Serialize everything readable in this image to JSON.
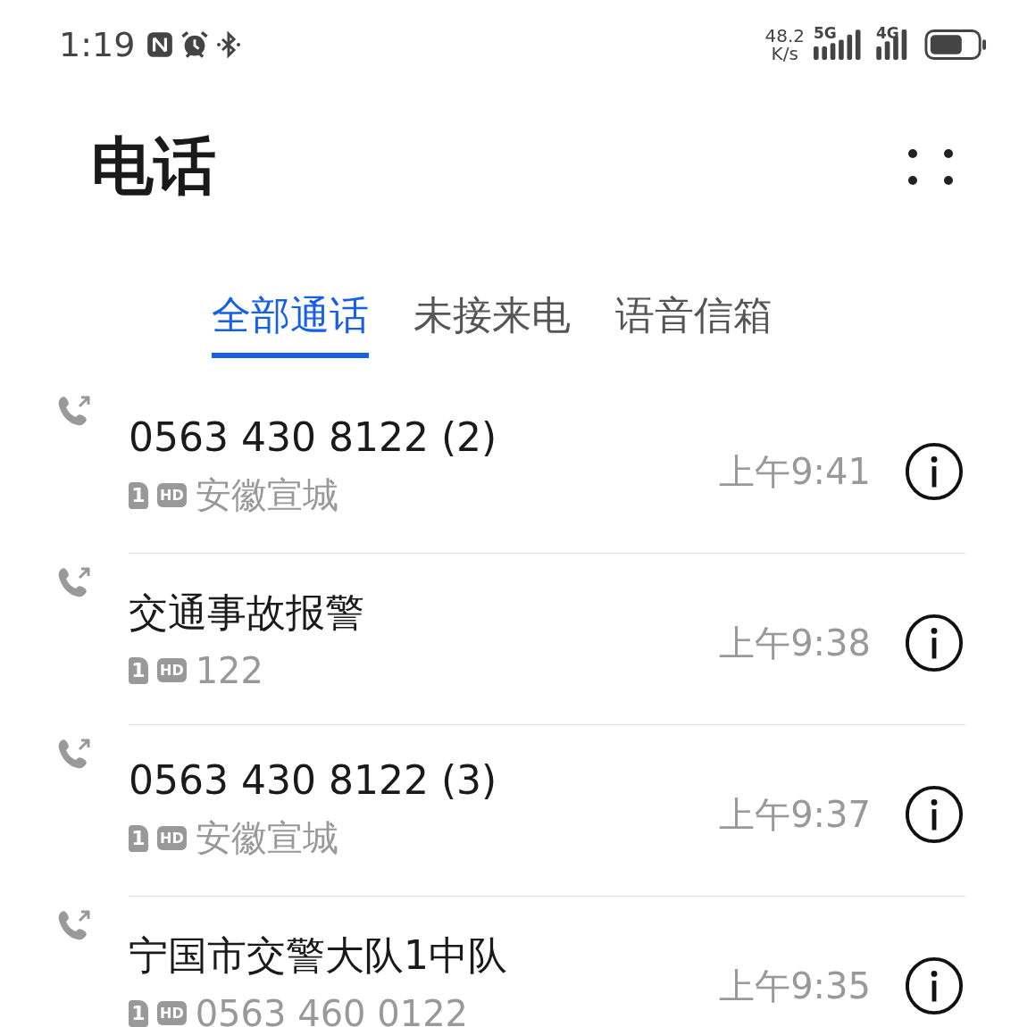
{
  "status_bar": {
    "time": "1:19",
    "speed_value": "48.2",
    "speed_unit": "K/s",
    "network_1": "5G",
    "network_2": "4G"
  },
  "title": "电话",
  "tabs": [
    {
      "label": "全部通话",
      "selected": true
    },
    {
      "label": "未接来电",
      "selected": false
    },
    {
      "label": "语音信箱",
      "selected": false
    }
  ],
  "calls": [
    {
      "name": "0563 430 8122 (2)",
      "sim": "1",
      "hd": "HD",
      "detail": "安徽宣城",
      "time": "上午9:41"
    },
    {
      "name": "交通事故报警",
      "sim": "1",
      "hd": "HD",
      "detail": "122",
      "time": "上午9:38"
    },
    {
      "name": "0563 430 8122 (3)",
      "sim": "1",
      "hd": "HD",
      "detail": "安徽宣城",
      "time": "上午9:37"
    },
    {
      "name": "宁国市交警大队1中队",
      "sim": "1",
      "hd": "HD",
      "detail": "0563 460 0122",
      "time": "上午9:35"
    }
  ]
}
